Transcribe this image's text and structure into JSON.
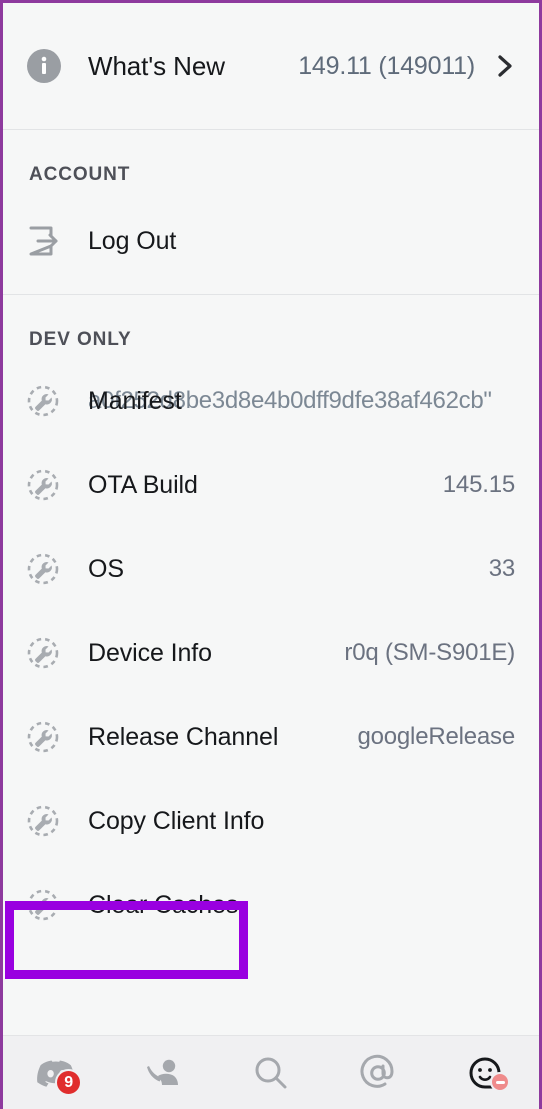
{
  "whats_new": {
    "label": "What's New",
    "value": "149.11 (149011)",
    "icon": "info-icon",
    "chevron": "chevron-right-icon"
  },
  "account": {
    "header": "ACCOUNT",
    "items": [
      {
        "label": "Log Out",
        "icon": "logout-icon"
      }
    ]
  },
  "dev_only": {
    "header": "DEV ONLY",
    "items": [
      {
        "label": "Manifest",
        "value": "a0f252d8be3d8e4b0dff9dfe38af462cb\"",
        "icon": "wrench-icon"
      },
      {
        "label": "OTA Build",
        "value": "145.15",
        "icon": "wrench-icon"
      },
      {
        "label": "OS",
        "value": "33",
        "icon": "wrench-icon"
      },
      {
        "label": "Device Info",
        "value": "r0q (SM-S901E)",
        "icon": "wrench-icon"
      },
      {
        "label": "Release Channel",
        "value": "googleRelease",
        "icon": "wrench-icon"
      },
      {
        "label": "Copy Client Info",
        "value": "",
        "icon": "wrench-icon"
      },
      {
        "label": "Clear Caches",
        "value": "",
        "icon": "wrench-icon"
      }
    ]
  },
  "highlight": {
    "target_label": "Clear Caches",
    "color": "#9900e0"
  },
  "bottom_nav": {
    "items": [
      {
        "name": "servers",
        "icon": "discord-logo-icon",
        "badge": "9"
      },
      {
        "name": "friends",
        "icon": "friends-icon",
        "badge": ""
      },
      {
        "name": "search",
        "icon": "search-icon",
        "badge": ""
      },
      {
        "name": "mentions",
        "icon": "at-mention-icon",
        "badge": ""
      },
      {
        "name": "profile",
        "icon": "avatar-smiley-icon",
        "badge": "dnd"
      }
    ]
  },
  "colors": {
    "background": "#f6f7f7",
    "nav_background": "#f0f0f2",
    "label_text": "#16181b",
    "value_text": "#6b7280",
    "section_header": "#4e5058",
    "divider": "#e2e4e6",
    "badge_red": "#e02d2d",
    "annotation_purple": "#9900e0",
    "frame_purple": "#8e3a9e"
  }
}
